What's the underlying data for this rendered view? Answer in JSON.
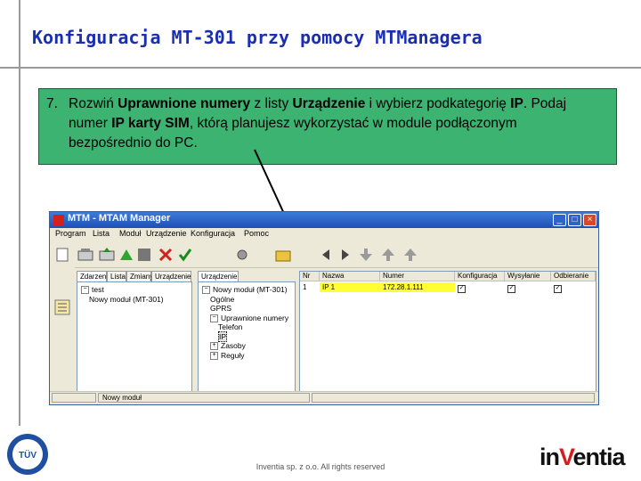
{
  "slide": {
    "title": "Konfiguracja MT-301 przy pomocy MTManagera",
    "footer": "Inventia sp. z o.o. All rights reserved",
    "logo_parts": [
      "in",
      "V",
      "entia"
    ],
    "badge_text": "TÜV"
  },
  "instruction": {
    "number": "7.",
    "text": "Rozwiń Uprawnione numery z listy Urządzenie i wybierz podkategorię IP. Podaj numer IP karty SIM, którą planujesz wykorzystać w module podłączonym bezpośrednio do PC.",
    "parts": [
      {
        "t": "Rozwiń ",
        "b": false
      },
      {
        "t": "Uprawnione numery",
        "b": true
      },
      {
        "t": " z listy ",
        "b": false
      },
      {
        "t": "Urządzenie",
        "b": true
      },
      {
        "t": " i wybierz podkategorię ",
        "b": false
      },
      {
        "t": "IP",
        "b": true
      },
      {
        "t": ". Podaj numer ",
        "b": false
      },
      {
        "t": "IP karty SIM",
        "b": true
      },
      {
        "t": ", którą planujesz wykorzystać w module podłączonym bezpośrednio do PC.",
        "b": false
      }
    ]
  },
  "window": {
    "title": "MTM - MTAM Manager",
    "controls": [
      "_",
      "□",
      "×"
    ],
    "menu": [
      "Program",
      "Lista",
      "Moduł",
      "Urządzenie",
      "Konfiguracja",
      "Pomoc"
    ],
    "toolbar_icons": [
      "new-icon",
      "read-icon",
      "write-icon",
      "connect-icon",
      "disconnect-icon",
      "delete-icon",
      "check-icon",
      "settings-icon",
      "folder-icon",
      "back-icon",
      "forward-icon",
      "arrow-down-icon",
      "arrow-up-icon",
      "arrow-up-icon"
    ],
    "left_tabs": [
      "Zdarzenia",
      "Lista",
      "Zmiany",
      "Urządzenie"
    ],
    "mid_tabs": [
      "Urządzenie"
    ],
    "left_tree": [
      {
        "label": "test",
        "indent": 0,
        "expander": "−"
      },
      {
        "label": "Nowy moduł (MT-301)",
        "indent": 1,
        "expander": ""
      }
    ],
    "mid_tree": [
      {
        "label": "Nowy moduł (MT-301)",
        "indent": 0,
        "expander": "−"
      },
      {
        "label": "Ogólne",
        "indent": 1,
        "expander": ""
      },
      {
        "label": "GPRS",
        "indent": 1,
        "expander": ""
      },
      {
        "label": "Uprawnione numery",
        "indent": 1,
        "expander": "−"
      },
      {
        "label": "Telefon",
        "indent": 2,
        "expander": ""
      },
      {
        "label": "IP",
        "indent": 2,
        "expander": ""
      },
      {
        "label": "Zasoby",
        "indent": 1,
        "expander": "+"
      },
      {
        "label": "Reguły",
        "indent": 1,
        "expander": "+"
      }
    ],
    "grid": {
      "headers": [
        "Nr",
        "Nazwa",
        "Numer",
        "Konfiguracja",
        "Wysyłanie",
        "Odbieranie"
      ],
      "rows": [
        {
          "nr": "1",
          "name": "IP 1",
          "number": "172.28.1.111",
          "config": "✓",
          "send": "✓",
          "recv": "✓"
        }
      ]
    },
    "status": "Nowy moduł"
  }
}
